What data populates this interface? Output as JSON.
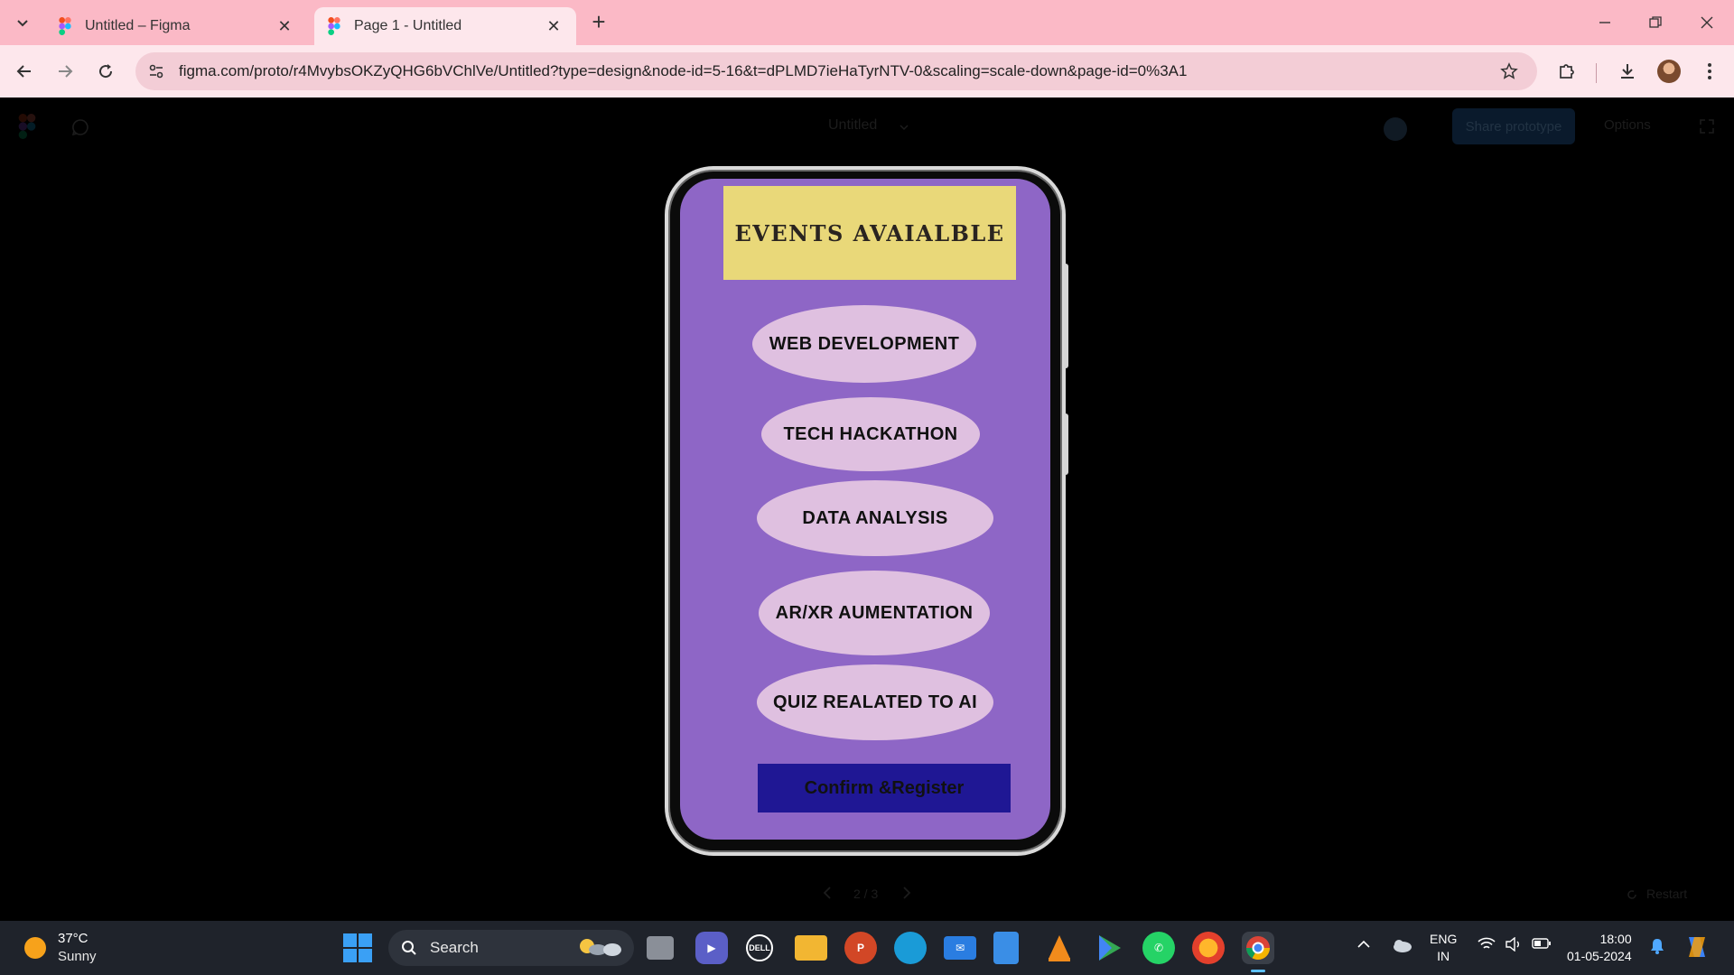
{
  "browser": {
    "tabs": [
      {
        "title": "Untitled – Figma",
        "active": false
      },
      {
        "title": "Page 1 - Untitled",
        "active": true
      }
    ],
    "url": "figma.com/proto/r4MvybsOKZyQHG6bVChlVe/Untitled?type=design&node-id=5-16&t=dPLMD7ieHaTyrNTV-0&scaling=scale-down&page-id=0%3A1",
    "theme_color": "#fbb9c6"
  },
  "viewer": {
    "file_title": "Untitled",
    "share_label": "Share prototype",
    "options_label": "Options",
    "page_indicator": "2 / 3",
    "restart_label": "Restart"
  },
  "prototype": {
    "banner_title": "EVENTS AVAIALBLE",
    "events": [
      {
        "label": "WEB DEVELOPMENT"
      },
      {
        "label": "TECH HACKATHON"
      },
      {
        "label": "DATA ANALYSIS"
      },
      {
        "label": "AR/XR AUMENTATION"
      },
      {
        "label": "QUIZ REALATED TO AI"
      }
    ],
    "confirm_label": "Confirm &Register",
    "colors": {
      "screen_bg": "#8e66c6",
      "banner_bg": "#e9d879",
      "oval_bg": "#dfc0e0",
      "button_bg": "#1f1794"
    }
  },
  "taskbar": {
    "weather_temp": "37°C",
    "weather_desc": "Sunny",
    "search_label": "Search",
    "lang_line1": "ENG",
    "lang_line2": "IN",
    "time": "18:00",
    "date": "01-05-2024",
    "apps": [
      "task-view",
      "teams",
      "dell",
      "file-explorer",
      "powerpoint",
      "edge",
      "mail",
      "notepad",
      "vlc",
      "play-store",
      "whatsapp",
      "firefox",
      "chrome"
    ]
  }
}
